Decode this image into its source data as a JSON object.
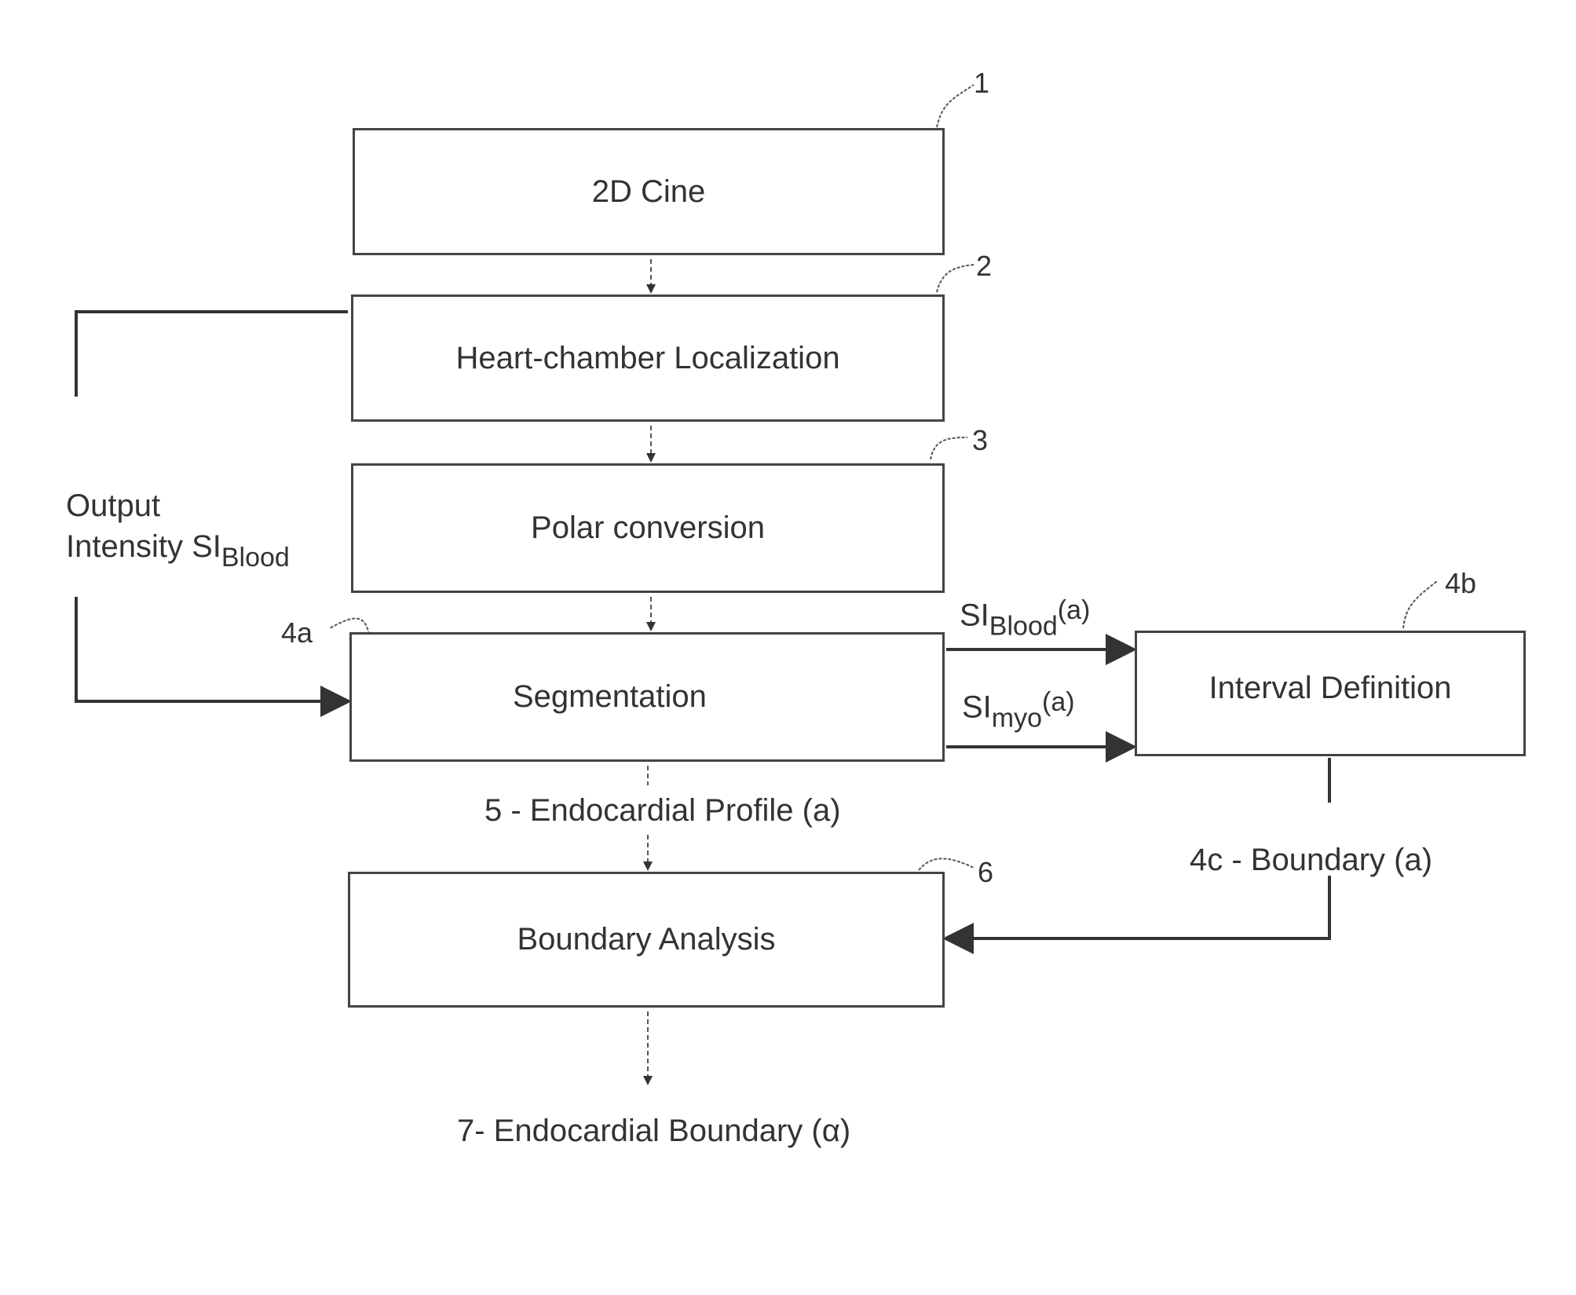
{
  "boxes": {
    "cine": {
      "ref": "1",
      "label": "2D Cine"
    },
    "localization": {
      "ref": "2",
      "label": "Heart-chamber Localization"
    },
    "polar": {
      "ref": "3",
      "label": "Polar conversion"
    },
    "segmentation": {
      "ref": "4a",
      "label": "Segmentation"
    },
    "interval": {
      "ref": "4b",
      "label": "Interval Definition"
    },
    "analysis": {
      "ref": "6",
      "label": "Boundary Analysis"
    }
  },
  "labels": {
    "output_line1": "Output",
    "output_line2": "Intensity SI",
    "output_sub": "Blood",
    "si_blood_main": "SI",
    "si_blood_sub": "Blood",
    "si_blood_arg": "(a)",
    "si_myo_main": "SI",
    "si_myo_sub": "myo",
    "si_myo_arg": "(a)",
    "profile": "5 - Endocardial Profile (a)",
    "boundary_4c": "4c - Boundary  (a)",
    "final": "7- Endocardial Boundary (α)"
  }
}
